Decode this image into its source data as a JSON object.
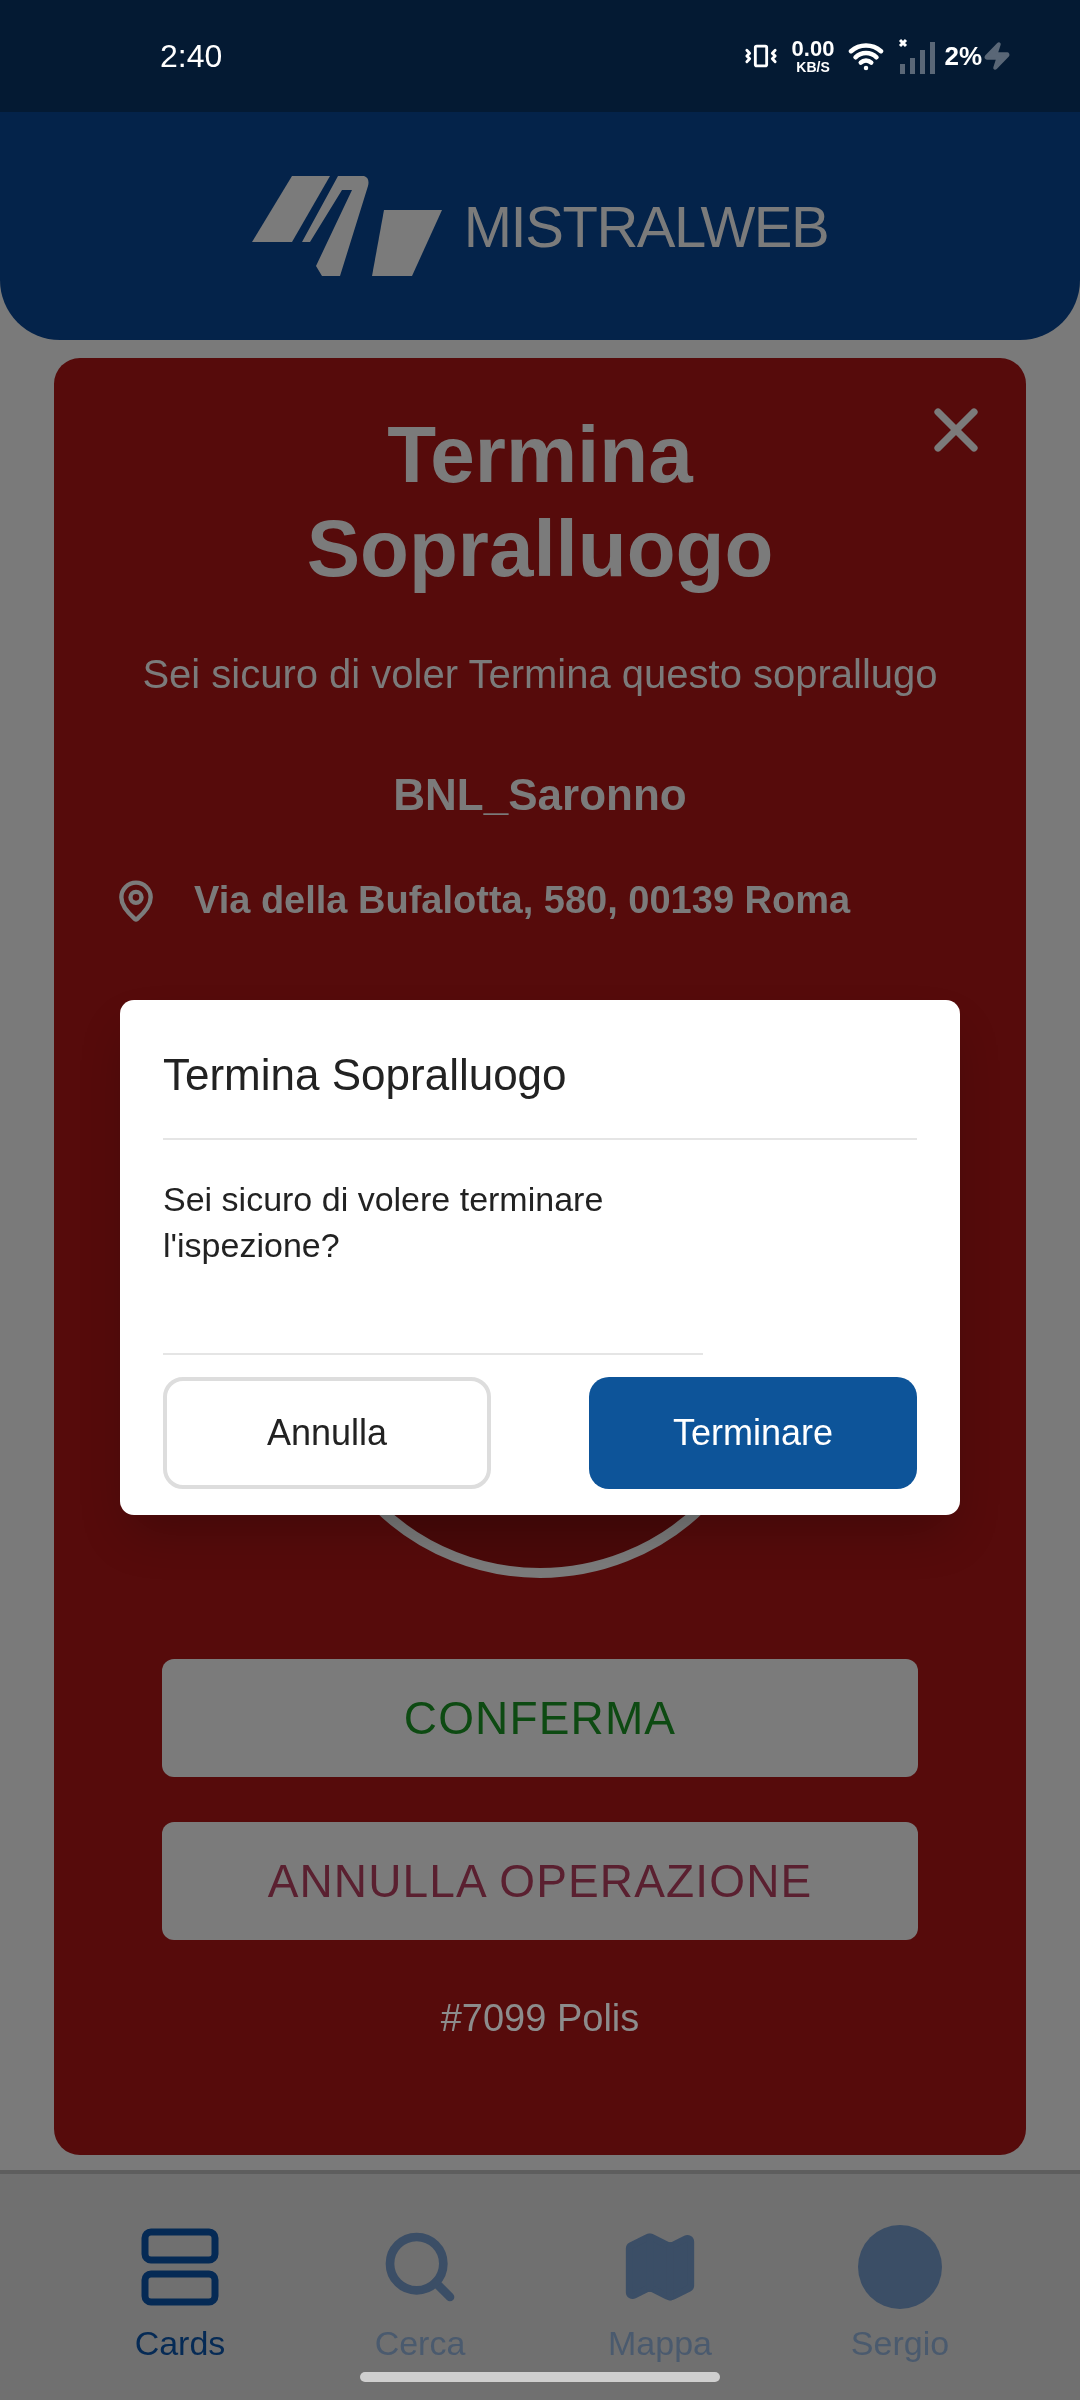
{
  "status_bar": {
    "time": "2:40",
    "network_speed": "0.00",
    "network_speed_unit": "KB/S",
    "battery": "2%",
    "charging": true
  },
  "header": {
    "brand": "MISTRALWEB"
  },
  "card": {
    "title": "Termina Sopralluogo",
    "subtitle": "Sei sicuro di voler Termina questo soprallugo",
    "site": "BNL_Saronno",
    "address": "Via della Bufalotta, 580, 00139 Roma",
    "buttons": [
      {
        "label": "CONFERMA",
        "kind": "confirm"
      },
      {
        "label": "ANNULLA OPERAZIONE",
        "kind": "cancel"
      }
    ],
    "footer": "#7099 Polis"
  },
  "dialog": {
    "title": "Termina Sopralluogo",
    "message": "Sei sicuro di volere terminare l'ispezione?",
    "buttons": [
      {
        "label": "Annulla",
        "kind": "secondary"
      },
      {
        "label": "Terminare",
        "kind": "primary"
      }
    ]
  },
  "bottom_nav": [
    {
      "label": "Cards",
      "kind": "cards",
      "selected": true
    },
    {
      "label": "Cerca",
      "kind": "search",
      "selected": false
    },
    {
      "label": "Mappa",
      "kind": "map",
      "selected": false
    },
    {
      "label": "Sergio",
      "kind": "avatar",
      "selected": false
    }
  ]
}
